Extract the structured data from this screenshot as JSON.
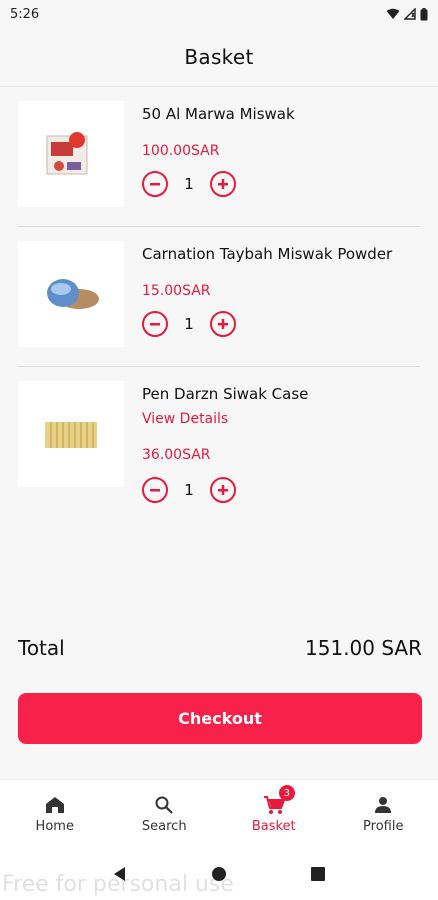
{
  "status_bar": {
    "time": "5:26"
  },
  "header": {
    "title": "Basket"
  },
  "items": [
    {
      "name": "50 Al Marwa Miswak",
      "price": "100.00SAR",
      "quantity": "1"
    },
    {
      "name": "Carnation Taybah Miswak Powder",
      "price": "15.00SAR",
      "quantity": "1"
    },
    {
      "name": "Pen Darzn Siwak Case",
      "link": "View Details",
      "price": "36.00SAR",
      "quantity": "1"
    }
  ],
  "summary": {
    "total_label": "Total",
    "total_value": "151.00 SAR"
  },
  "checkout_label": "Checkout",
  "bottom_nav": {
    "items": [
      {
        "label": "Home",
        "icon": "home-icon"
      },
      {
        "label": "Search",
        "icon": "search-icon"
      },
      {
        "label": "Basket",
        "icon": "cart-icon",
        "badge": "3",
        "active": true
      },
      {
        "label": "Profile",
        "icon": "person-icon"
      }
    ]
  },
  "watermark": "Free for personal use",
  "colors": {
    "accent": "#e8193c",
    "checkout": "#f8214a"
  }
}
